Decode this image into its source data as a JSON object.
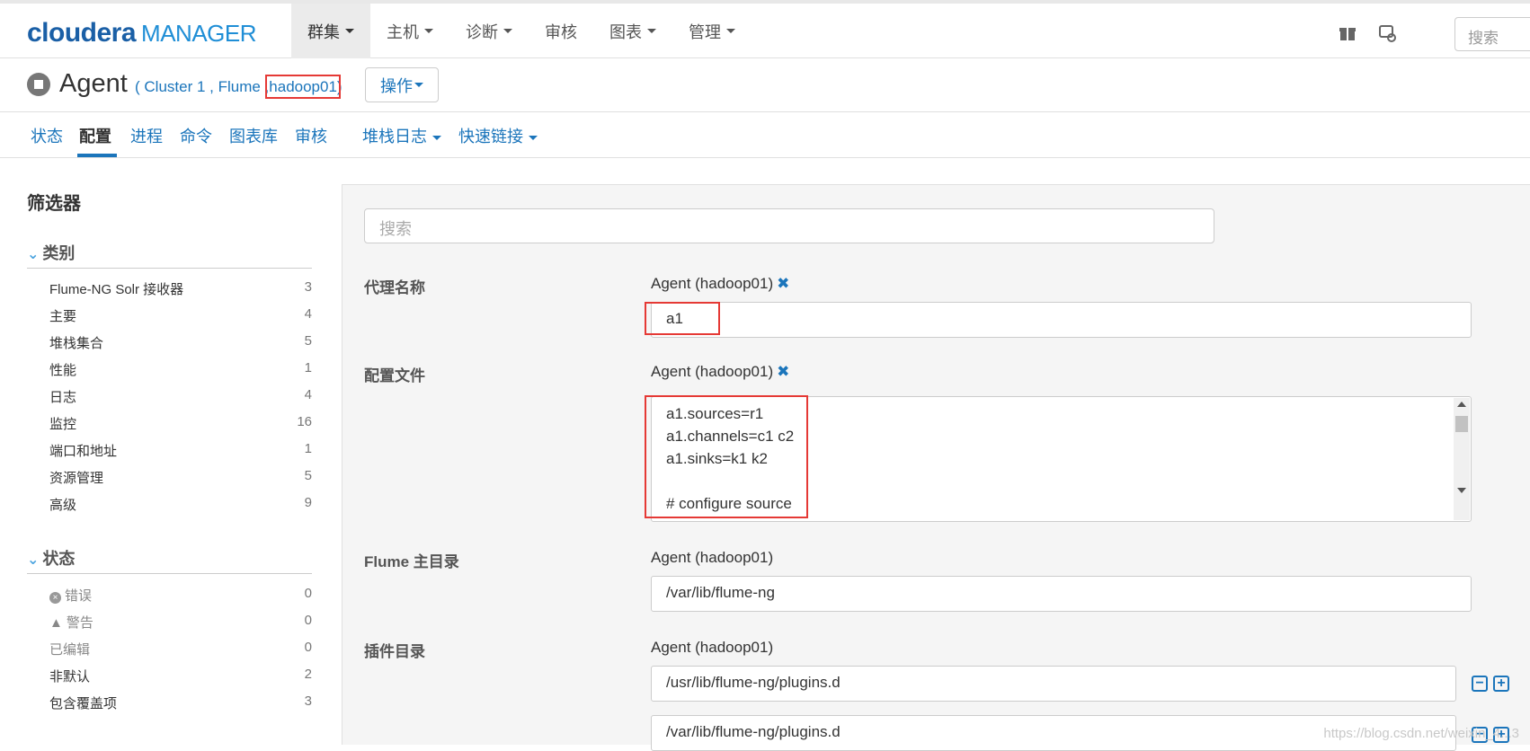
{
  "brand": {
    "part1": "cloudera",
    "part2": "MANAGER"
  },
  "nav": [
    {
      "label": "群集",
      "caret": true
    },
    {
      "label": "主机",
      "caret": true
    },
    {
      "label": "诊断",
      "caret": true
    },
    {
      "label": "审核",
      "caret": false
    },
    {
      "label": "图表",
      "caret": true
    },
    {
      "label": "管理",
      "caret": true
    }
  ],
  "top_search_placeholder": "搜索",
  "title": {
    "name": "Agent",
    "crumb_open": "( ",
    "cluster": "Cluster 1",
    "sep1": " , ",
    "service": "Flume",
    "sep2": " ,",
    "host": "hadoop01",
    "crumb_close": ")"
  },
  "actions_label": "操作",
  "subnav": {
    "status": "状态",
    "config": "配置",
    "process": "进程",
    "command": "命令",
    "charts": "图表库",
    "audit": "审核",
    "stack_logs": "堆栈日志",
    "quick_links": "快速链接"
  },
  "sidebar": {
    "title": "筛选器",
    "category_head": "类别",
    "categories": [
      {
        "label": "Flume-NG Solr 接收器",
        "count": "3"
      },
      {
        "label": "主要",
        "count": "4"
      },
      {
        "label": "堆栈集合",
        "count": "5"
      },
      {
        "label": "性能",
        "count": "1"
      },
      {
        "label": "日志",
        "count": "4"
      },
      {
        "label": "监控",
        "count": "16"
      },
      {
        "label": "端口和地址",
        "count": "1"
      },
      {
        "label": "资源管理",
        "count": "5"
      },
      {
        "label": "高级",
        "count": "9"
      }
    ],
    "status_head": "状态",
    "statuses": [
      {
        "label": "错误",
        "count": "0"
      },
      {
        "label": "警告",
        "count": "0"
      },
      {
        "label": "已编辑",
        "count": "0"
      },
      {
        "label": "非默认",
        "count": "2"
      },
      {
        "label": "包含覆盖项",
        "count": "3"
      }
    ]
  },
  "main": {
    "search_placeholder": "搜索",
    "agent_name_label": "代理名称",
    "agent_name_scope": "Agent (hadoop01)",
    "agent_name_value": "a1",
    "config_file_label": "配置文件",
    "config_file_scope": "Agent (hadoop01)",
    "config_lines": [
      "a1.sources=r1",
      "a1.channels=c1 c2",
      "a1.sinks=k1 k2",
      "",
      "# configure source"
    ],
    "flume_home_label": "Flume 主目录",
    "flume_home_scope": "Agent (hadoop01)",
    "flume_home_value": "/var/lib/flume-ng",
    "plugin_dir_label": "插件目录",
    "plugin_dir_scope": "Agent (hadoop01)",
    "plugin_dir_1": "/usr/lib/flume-ng/plugins.d",
    "plugin_dir_2": "/var/lib/flume-ng/plugins.d"
  },
  "watermark": "https://blog.csdn.net/weixin_4...3"
}
